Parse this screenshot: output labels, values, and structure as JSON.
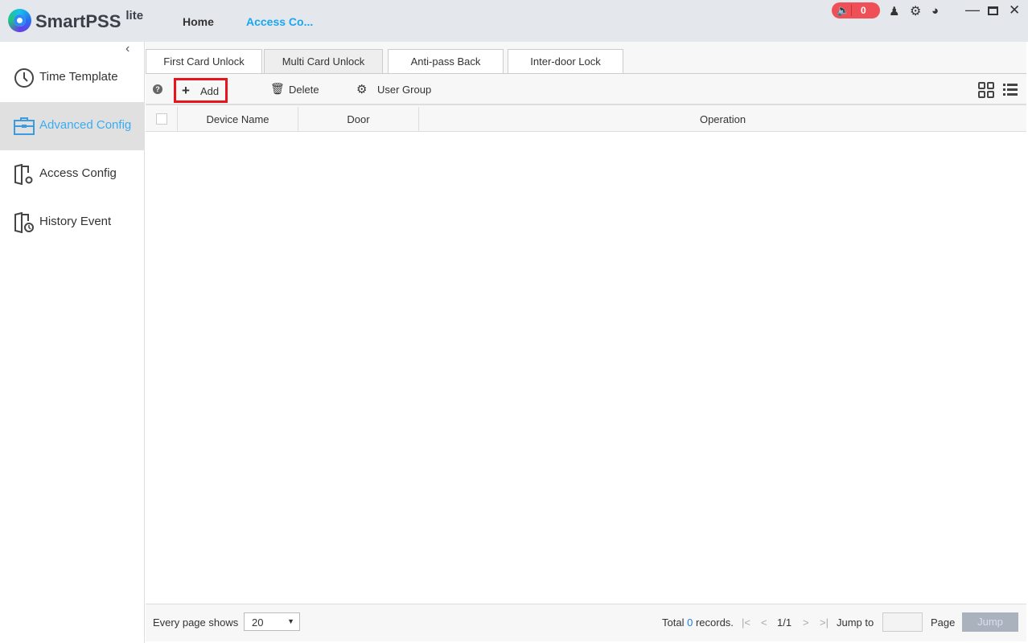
{
  "header": {
    "brand": "SmartPSS",
    "brand_suffix": "lite",
    "nav": [
      "Home",
      "Access Co..."
    ],
    "alarm_count": "0"
  },
  "sidebar": {
    "items": [
      {
        "label": "Time Template"
      },
      {
        "label": "Advanced Config"
      },
      {
        "label": "Access Config"
      },
      {
        "label": "History Event"
      }
    ]
  },
  "tabs": [
    "First Card Unlock",
    "Multi Card Unlock",
    "Anti-pass Back",
    "Inter-door Lock"
  ],
  "toolbar": {
    "add": "Add",
    "delete": "Delete",
    "user_group": "User Group"
  },
  "table": {
    "columns": [
      "Device Name",
      "Door",
      "Operation"
    ],
    "rows": []
  },
  "footer": {
    "every_page": "Every page shows",
    "page_size": "20",
    "total_prefix": "Total",
    "total_count": "0",
    "total_suffix": "records.",
    "page_indicator": "1/1",
    "jump_to": "Jump to",
    "page": "Page",
    "jump": "Jump"
  },
  "colors": {
    "accent": "#3aacf0",
    "alarm": "#ef5057",
    "highlight": "#e8141c"
  }
}
